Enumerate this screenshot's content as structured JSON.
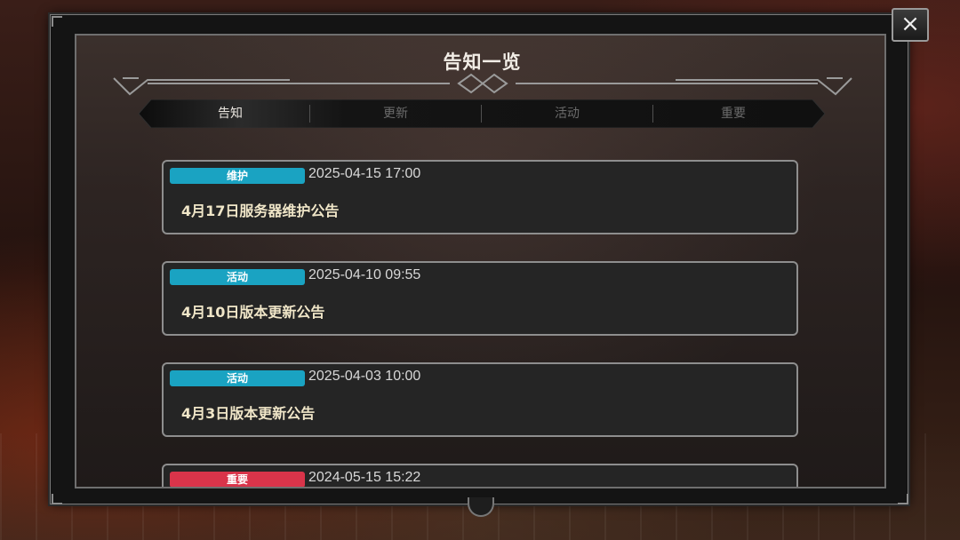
{
  "dialog": {
    "title": "告知一览",
    "close_icon": "×"
  },
  "tabs": [
    {
      "label": "告知",
      "active": true
    },
    {
      "label": "更新",
      "active": false
    },
    {
      "label": "活动",
      "active": false
    },
    {
      "label": "重要",
      "active": false
    }
  ],
  "notices": [
    {
      "badge": "维护",
      "badge_color": "#1aa3c2",
      "date": "2025-04-15 17:00",
      "title": "4月17日服务器维护公告"
    },
    {
      "badge": "活动",
      "badge_color": "#1aa3c2",
      "date": "2025-04-10 09:55",
      "title": "4月10日版本更新公告"
    },
    {
      "badge": "活动",
      "badge_color": "#1aa3c2",
      "date": "2025-04-03 10:00",
      "title": "4月3日版本更新公告"
    },
    {
      "badge": "重要",
      "badge_color": "#d9344a",
      "date": "2024-05-15 15:22",
      "title": ""
    }
  ],
  "colors": {
    "accent_blue": "#1aa3c2",
    "accent_red": "#d9344a"
  }
}
